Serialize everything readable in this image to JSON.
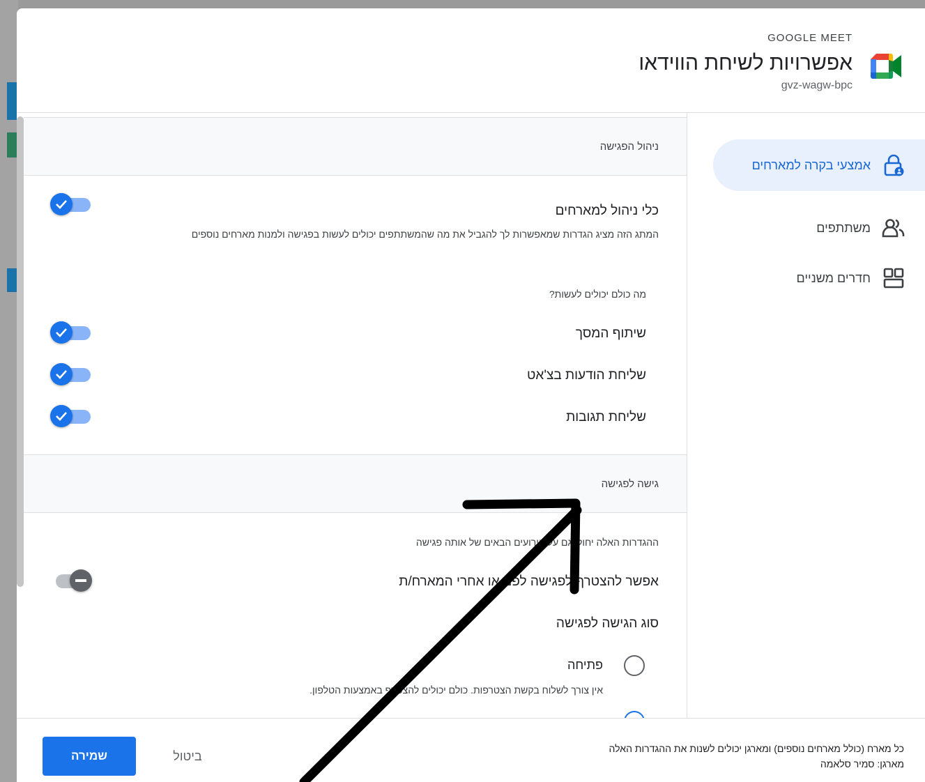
{
  "header": {
    "app_label": "GOOGLE MEET",
    "title": "אפשרויות לשיחת הווידאו",
    "meeting_code": "gvz-wagw-bpc"
  },
  "sidebar": {
    "items": [
      {
        "label": "אמצעי בקרה למארחים",
        "icon": "lock-person-icon",
        "active": true
      },
      {
        "label": "משתתפים",
        "icon": "people-icon",
        "active": false
      },
      {
        "label": "חדרים משניים",
        "icon": "rooms-grid-icon",
        "active": false
      }
    ]
  },
  "meeting_management": {
    "section_title": "ניהול הפגישה",
    "host_management_label": "כלי ניהול למארחים",
    "host_management_desc": "המתג הזה מציג הגדרות שמאפשרות לך להגביל את מה שהמשתתפים יכולים לעשות בפגישה ולמנות מארחים נוספים",
    "host_management_on": true,
    "everyone_can_title": "מה כולם יכולים לעשות?",
    "share_screen_label": "שיתוף המסך",
    "share_screen_on": true,
    "chat_label": "שליחת הודעות בצ'אט",
    "chat_on": true,
    "reactions_label": "שליחת תגובות",
    "reactions_on": true
  },
  "meeting_access": {
    "section_title": "גישה לפגישה",
    "note": "ההגדרות האלה יחולו גם על אירועים הבאים של אותה פגישה",
    "join_before_host_label": "אפשר להצטרף לפגישה לפני או אחרי המארח/ת",
    "join_before_host_on": false,
    "access_type_title": "סוג הגישה לפגישה",
    "open_label": "פתיחה",
    "open_desc": "אין צורך לשלוח בקשת הצטרפות. כולם יכולים להצטרף באמצעות הטלפון."
  },
  "footer": {
    "note_line1": "כל מארח (כולל מארחים נוספים) ומארגן יכולים לשנות את ההגדרות האלה",
    "note_line2": "מארגן: סמיר סלאמה",
    "cancel_label": "ביטול",
    "save_label": "שמירה"
  },
  "colors": {
    "accent": "#1a73e8",
    "active_bg": "#e8f0fe",
    "active_text": "#1967d2"
  }
}
